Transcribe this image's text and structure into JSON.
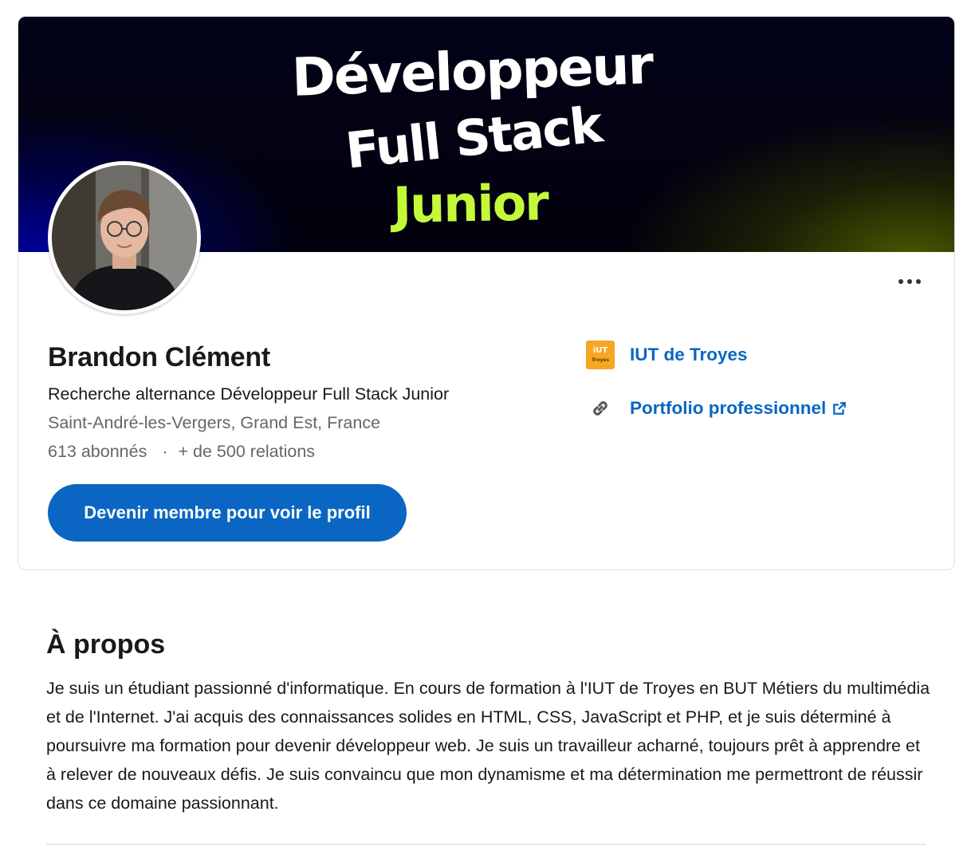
{
  "banner": {
    "line1": "Développeur",
    "line2": "Full Stack",
    "line3": "Junior",
    "accent_color": "#c4f93a"
  },
  "profile": {
    "name": "Brandon Clément",
    "headline": "Recherche alternance Développeur Full Stack Junior",
    "location": "Saint-André-les-Vergers, Grand Est, France",
    "followers": "613 abonnés",
    "separator": "·",
    "connections": "+ de 500 relations",
    "join_button": "Devenir membre pour voir le profil"
  },
  "sidebar_links": {
    "school": {
      "label": "IUT de Troyes",
      "logo_top": "iUT",
      "logo_bottom": "Troyes",
      "icon": "school-logo"
    },
    "portfolio": {
      "label": "Portfolio professionnel",
      "icon": "link-icon",
      "trailing_icon": "external-link-icon"
    }
  },
  "about": {
    "title": "À propos",
    "text": "Je suis un étudiant passionné d'informatique. En cours de formation à l'IUT de Troyes en BUT Métiers du multimédia et de l'Internet. J'ai acquis des connaissances solides en HTML, CSS, JavaScript et PHP, et je suis déterminé à poursuivre ma formation pour devenir développeur web. Je suis un travailleur acharné, toujours prêt à apprendre et à relever de nouveaux défis. Je suis convaincu que mon dynamisme et ma détermination me permettront de réussir dans ce domaine passionnant."
  },
  "colors": {
    "brand_blue": "#0a66c2",
    "text_primary": "#191919",
    "text_secondary": "#666666"
  }
}
